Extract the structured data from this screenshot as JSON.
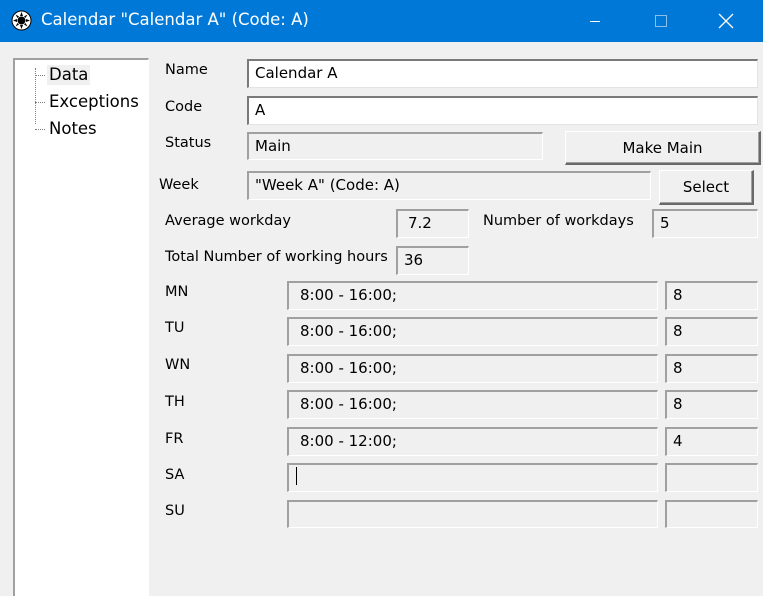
{
  "window": {
    "title": "Calendar \"Calendar A\" (Code: A)"
  },
  "tree": {
    "items": [
      "Data",
      "Exceptions",
      "Notes"
    ],
    "selected": "Data"
  },
  "form": {
    "name_label": "Name",
    "name_value": "Calendar A",
    "code_label": "Code",
    "code_value": "A",
    "status_label": "Status",
    "status_value": "Main",
    "make_main_button": "Make Main",
    "week_label": "Week",
    "week_value": "\"Week A\" (Code: A)",
    "select_button": "Select",
    "avg_workday_label": "Average workday",
    "avg_workday_value": "7.2",
    "num_workdays_label": "Number of workdays",
    "num_workdays_value": "5",
    "total_hours_label": "Total Number of working hours",
    "total_hours_value": "36"
  },
  "days": [
    {
      "label": "MN",
      "schedule": "8:00 - 16:00;",
      "hours": "8"
    },
    {
      "label": "TU",
      "schedule": "8:00 - 16:00;",
      "hours": "8"
    },
    {
      "label": "WN",
      "schedule": "8:00 - 16:00;",
      "hours": "8"
    },
    {
      "label": "TH",
      "schedule": "8:00 - 16:00;",
      "hours": "8"
    },
    {
      "label": "FR",
      "schedule": "8:00 - 12:00;",
      "hours": "4"
    },
    {
      "label": "SA",
      "schedule": "",
      "hours": ""
    },
    {
      "label": "SU",
      "schedule": "",
      "hours": ""
    }
  ],
  "colors": {
    "titlebar": "#0078d7",
    "window_bg": "#f0f0f0"
  }
}
